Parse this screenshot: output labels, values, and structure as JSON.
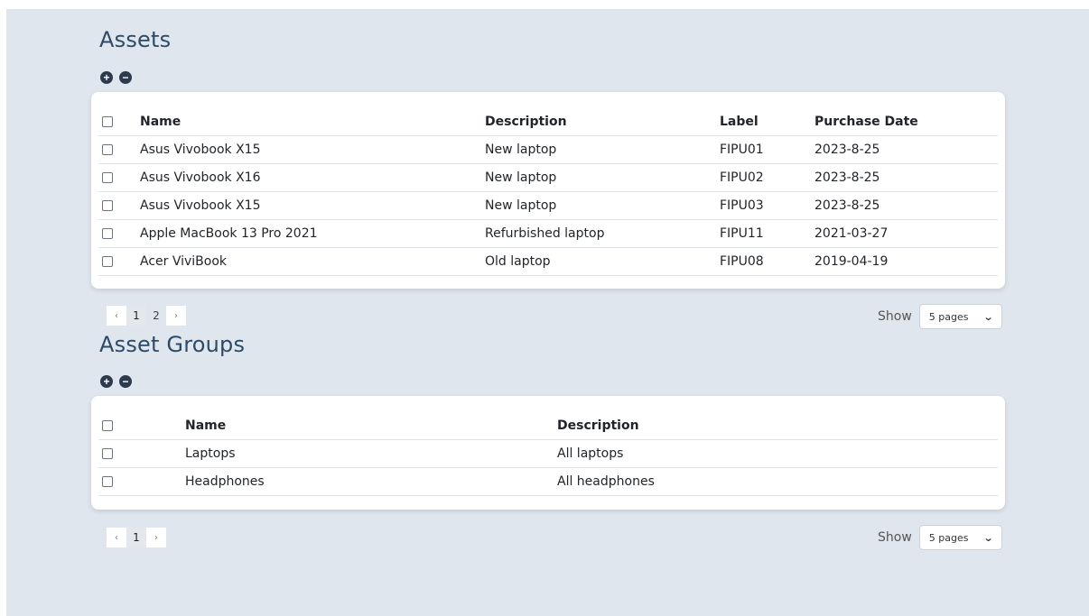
{
  "assets": {
    "title": "Assets",
    "add_icon": "+",
    "remove_icon": "−",
    "columns": [
      "Name",
      "Description",
      "Label",
      "Purchase Date"
    ],
    "rows": [
      {
        "name": "Asus Vivobook X15",
        "description": "New laptop",
        "label": "FIPU01",
        "date": "2023-8-25"
      },
      {
        "name": "Asus Vivobook X16",
        "description": "New laptop",
        "label": "FIPU02",
        "date": "2023-8-25"
      },
      {
        "name": "Asus Vivobook X15",
        "description": "New laptop",
        "label": "FIPU03",
        "date": "2023-8-25"
      },
      {
        "name": "Apple MacBook 13 Pro 2021",
        "description": "Refurbished laptop",
        "label": "FIPU11",
        "date": "2021-03-27"
      },
      {
        "name": "Acer ViviBook",
        "description": "Old laptop",
        "label": "FIPU08",
        "date": "2019-04-19"
      }
    ],
    "pagination": {
      "prev": "‹",
      "pages": [
        "1",
        "2"
      ],
      "next": "›"
    },
    "show_label": "Show",
    "page_size": "5 pages"
  },
  "groups": {
    "title": "Asset Groups",
    "add_icon": "+",
    "remove_icon": "−",
    "columns": [
      "Name",
      "Description"
    ],
    "rows": [
      {
        "name": "Laptops",
        "description": "All laptops"
      },
      {
        "name": "Headphones",
        "description": "All headphones"
      }
    ],
    "pagination": {
      "prev": "‹",
      "pages": [
        "1"
      ],
      "next": "›"
    },
    "show_label": "Show",
    "page_size": "5 pages"
  },
  "icons": {
    "select_chevron": "chevron-down-icon",
    "add": "plus-icon",
    "remove": "minus-icon"
  }
}
